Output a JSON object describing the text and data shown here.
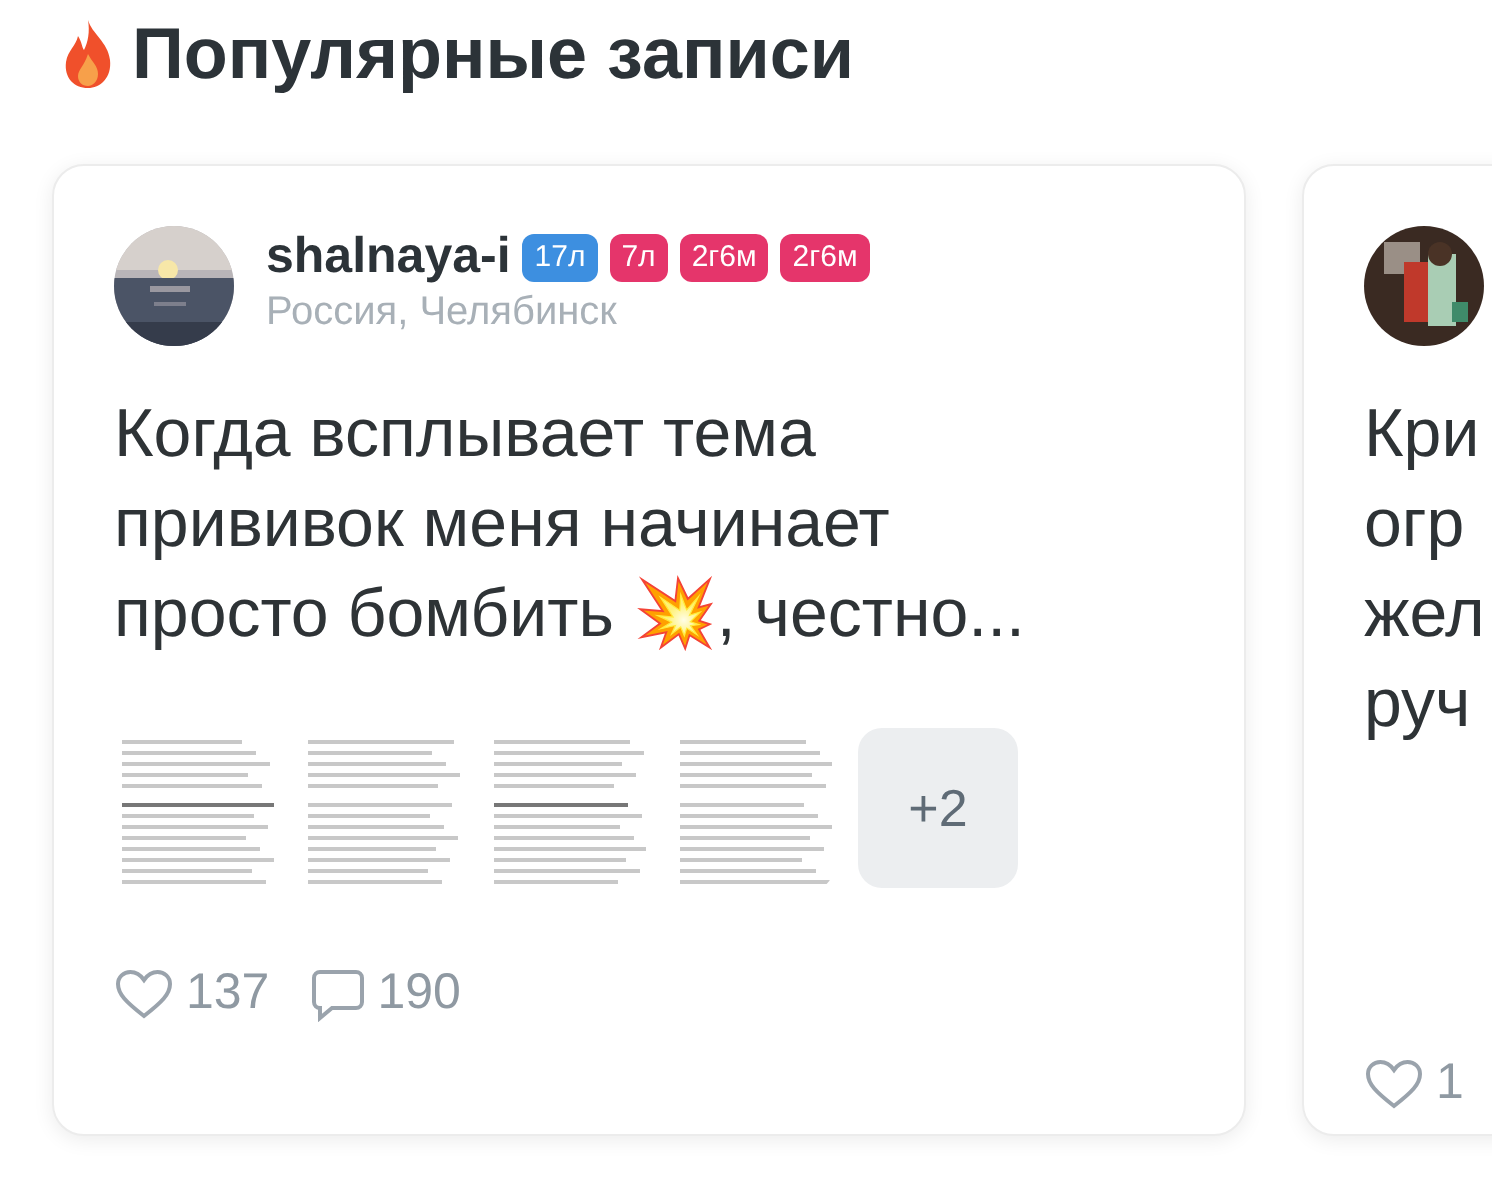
{
  "section": {
    "title": "Популярные записи"
  },
  "posts": [
    {
      "author": {
        "name": "shalnaya-i",
        "location": "Россия, Челябинск",
        "badges": [
          {
            "text": "17л",
            "color": "#3d8fe0"
          },
          {
            "text": "7л",
            "color": "#e5356b"
          },
          {
            "text": "2г6м",
            "color": "#e5356b"
          },
          {
            "text": "2г6м",
            "color": "#e5356b"
          }
        ]
      },
      "text_lines": [
        "Когда всплывает тема",
        "прививок меня начинает",
        "просто бомбить 💥, честно..."
      ],
      "attachments": [
        {
          "kind": "picture"
        },
        {
          "kind": "picture"
        },
        {
          "kind": "picture"
        },
        {
          "kind": "picture"
        }
      ],
      "more": "+2",
      "likes": "137",
      "comments": "190"
    },
    {
      "text_lines": [
        "Кри",
        "огр",
        "жел",
        "руч"
      ],
      "likes": "1"
    }
  ]
}
